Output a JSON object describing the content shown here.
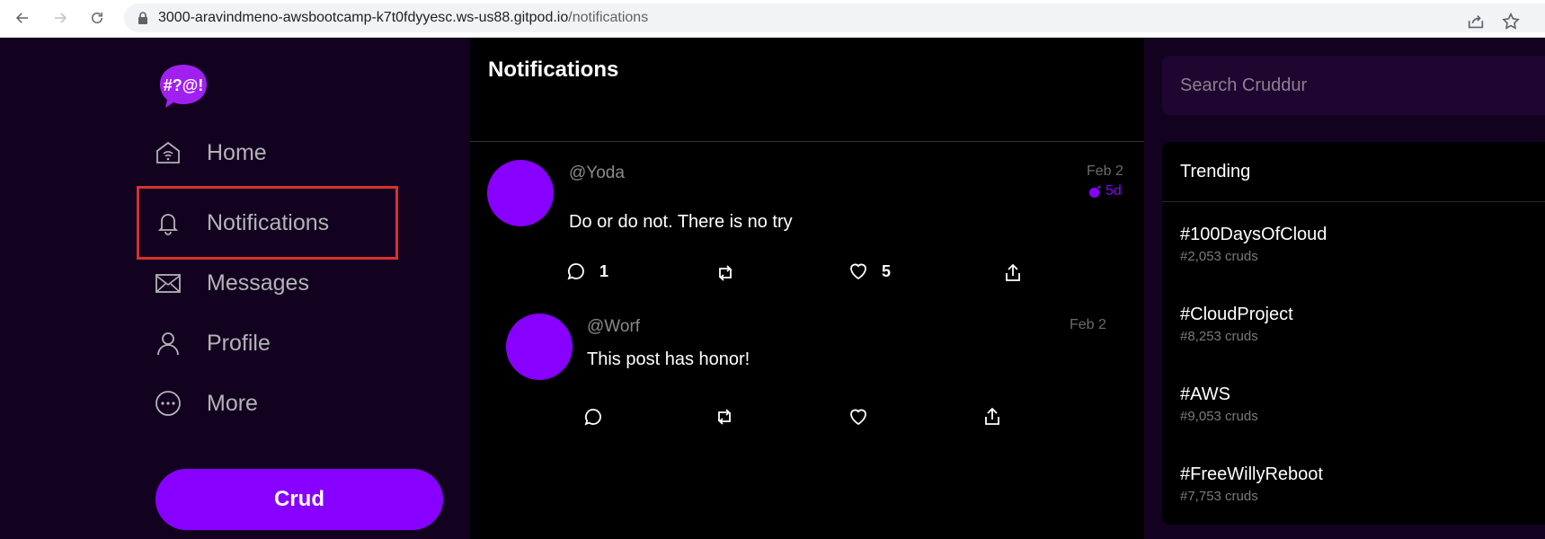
{
  "browser": {
    "url_host": "3000-aravindmeno-awsbootcamp-k7t0fdyyesc.ws-us88.gitpod.io",
    "url_path": "/notifications"
  },
  "sidebar": {
    "logo_text": "#?@!",
    "items": [
      {
        "label": "Home",
        "icon": "home-icon"
      },
      {
        "label": "Notifications",
        "icon": "bell-icon",
        "active": true
      },
      {
        "label": "Messages",
        "icon": "envelope-icon"
      },
      {
        "label": "Profile",
        "icon": "person-icon"
      },
      {
        "label": "More",
        "icon": "more-icon"
      }
    ],
    "crud_button": "Crud"
  },
  "main": {
    "title": "Notifications",
    "posts": [
      {
        "handle": "@Yoda",
        "date": "Feb 2",
        "expires": "5d",
        "text": "Do or do not. There is no try",
        "reply_count": "1",
        "like_count": "5"
      },
      {
        "handle": "@Worf",
        "date": "Feb 2",
        "text": "This post has honor!"
      }
    ]
  },
  "right": {
    "search_placeholder": "Search Cruddur",
    "trending_title": "Trending",
    "trends": [
      {
        "name": "#100DaysOfCloud",
        "count": "#2,053 cruds"
      },
      {
        "name": "#CloudProject",
        "count": "#8,253 cruds"
      },
      {
        "name": "#AWS",
        "count": "#9,053 cruds"
      },
      {
        "name": "#FreeWillyReboot",
        "count": "#7,753 cruds"
      }
    ]
  },
  "colors": {
    "accent": "#8800ff",
    "sidebar_bg": "#13021f",
    "active_outline": "#d93030"
  }
}
